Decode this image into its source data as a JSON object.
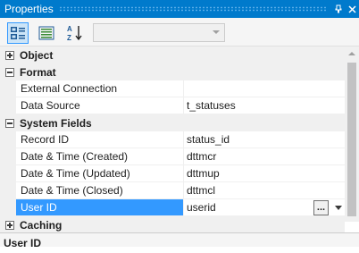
{
  "window": {
    "title": "Properties",
    "pin_glyph": "†",
    "close_glyph": "✕"
  },
  "toolbar": {
    "categorized_icon": "categorized-icon",
    "property_pages_icon": "property-pages-icon",
    "alphabetical_icon": "alphabetical-icon",
    "object_selector_value": ""
  },
  "grid": {
    "categories": {
      "object": "Object",
      "format": "Format",
      "system_fields": "System Fields",
      "caching": "Caching"
    },
    "format_props": [
      {
        "name": "External Connection",
        "value": ""
      },
      {
        "name": "Data Source",
        "value": "t_statuses"
      }
    ],
    "system_props": [
      {
        "name": "Record ID",
        "value": "status_id"
      },
      {
        "name": "Date & Time (Created)",
        "value": "dttmcr"
      },
      {
        "name": "Date & Time (Updated)",
        "value": "dttmup"
      },
      {
        "name": "Date & Time (Closed)",
        "value": "dttmcl"
      },
      {
        "name": "User ID",
        "value": "userid"
      }
    ],
    "ellipsis_label": "..."
  },
  "description": {
    "title": "User ID"
  },
  "colors": {
    "titlebar": "#007acc",
    "selection": "#3399ff",
    "category_bg": "#f0f0f0"
  }
}
